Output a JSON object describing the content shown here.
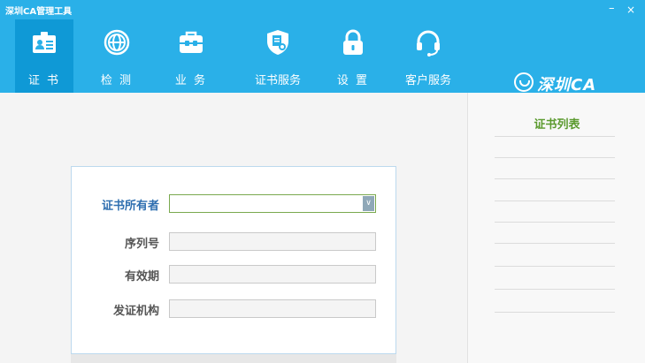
{
  "window": {
    "title": "深圳CA管理工具",
    "minimize": "–",
    "close": "×"
  },
  "nav": [
    {
      "id": "cert",
      "label": "证 书",
      "icon": "id-card-icon",
      "active": true
    },
    {
      "id": "detect",
      "label": "检 测",
      "icon": "globe-icon"
    },
    {
      "id": "business",
      "label": "业 务",
      "icon": "briefcase-icon"
    },
    {
      "id": "cert-service",
      "label": "证书服务",
      "icon": "certificate-shield-icon"
    },
    {
      "id": "settings",
      "label": "设 置",
      "icon": "lock-icon"
    },
    {
      "id": "customer-service",
      "label": "客户服务",
      "icon": "headset-icon"
    }
  ],
  "brand": {
    "logo_text": "深圳CA",
    "icon": "szca-logo-icon"
  },
  "form": {
    "owner_label": "证书所有者",
    "owner_value": "",
    "serial_label": "序列号",
    "serial_value": "",
    "validity_label": "有效期",
    "validity_value": "",
    "issuer_label": "发证机构",
    "issuer_value": ""
  },
  "cert_list": {
    "title": "证书列表",
    "items": []
  },
  "colors": {
    "header": "#2ab0e8",
    "active_tab": "#0f99d6",
    "list_title": "#5b9a2e"
  }
}
